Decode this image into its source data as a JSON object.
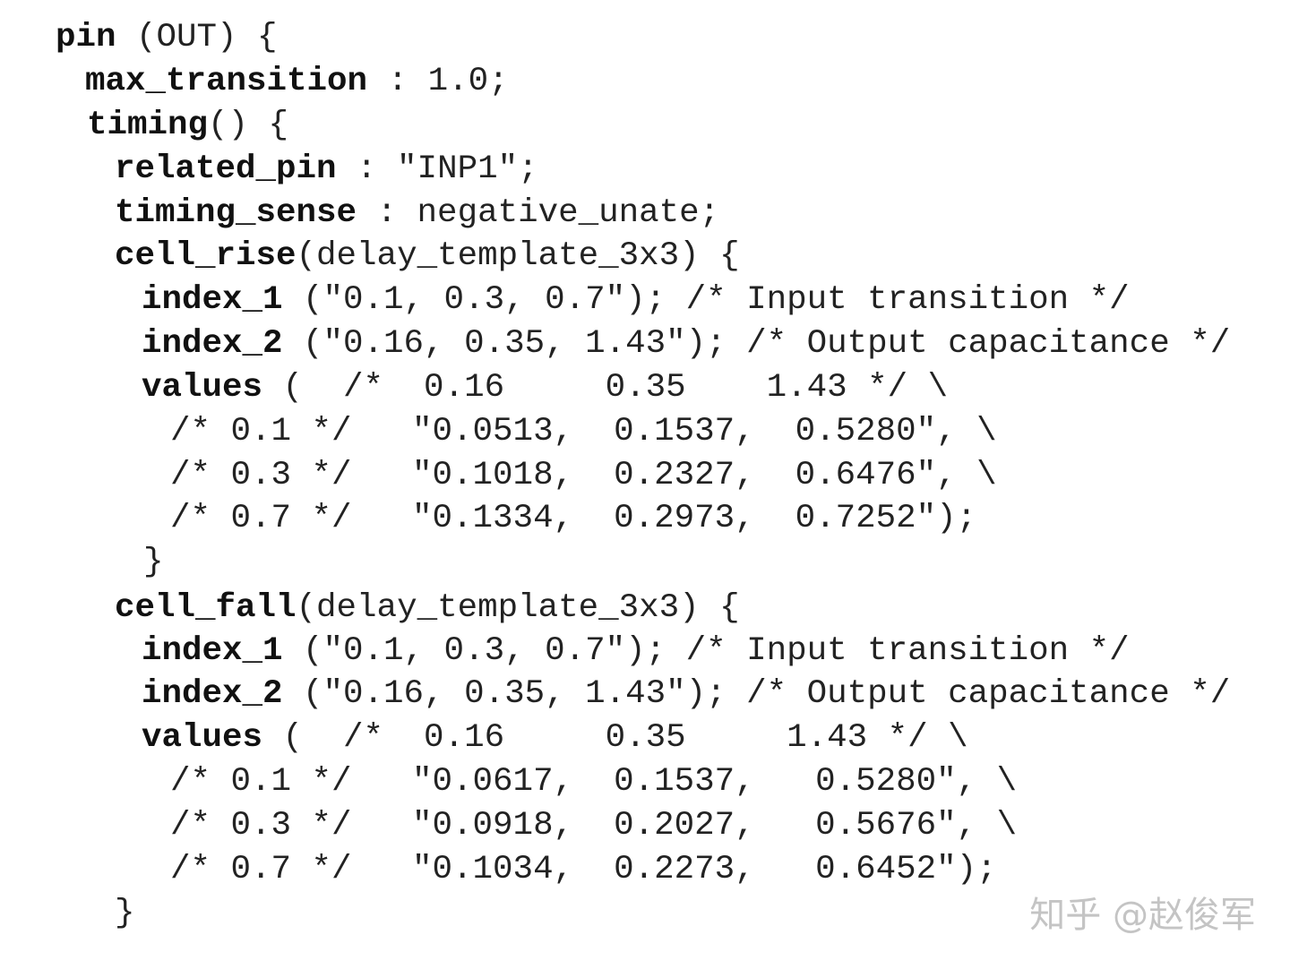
{
  "lines": [
    {
      "kw": "pin",
      "rest": " (OUT) {"
    },
    {
      "kw": "max_transition",
      "rest": " : 1.0;"
    },
    {
      "kw": "timing",
      "rest": "() {"
    },
    {
      "kw": "related_pin",
      "rest": " : \"INP1\";"
    },
    {
      "kw": "timing_sense",
      "rest": " : negative_unate;"
    },
    {
      "kw": "cell_rise",
      "rest": "(delay_template_3x3) {"
    },
    {
      "kw": "index_1",
      "rest": " (\"0.1, 0.3, 0.7\"); /* Input transition */"
    },
    {
      "kw": "index_2",
      "rest": " (\"0.16, 0.35, 1.43\"); /* Output capacitance */"
    },
    {
      "kw": "values",
      "rest": " (  /*  0.16     0.35    1.43 */ \\"
    },
    {
      "kw": "",
      "rest": "/* 0.1 */   \"0.0513,  0.1537,  0.5280\", \\"
    },
    {
      "kw": "",
      "rest": "/* 0.3 */   \"0.1018,  0.2327,  0.6476\", \\"
    },
    {
      "kw": "",
      "rest": "/* 0.7 */   \"0.1334,  0.2973,  0.7252\");"
    },
    {
      "kw": "",
      "rest": "}"
    },
    {
      "kw": "cell_fall",
      "rest": "(delay_template_3x3) {"
    },
    {
      "kw": "index_1",
      "rest": " (\"0.1, 0.3, 0.7\"); /* Input transition */"
    },
    {
      "kw": "index_2",
      "rest": " (\"0.16, 0.35, 1.43\"); /* Output capacitance */"
    },
    {
      "kw": "values",
      "rest": " (  /*  0.16     0.35     1.43 */ \\"
    },
    {
      "kw": "",
      "rest": "/* 0.1 */   \"0.0617,  0.1537,   0.5280\", \\"
    },
    {
      "kw": "",
      "rest": "/* 0.3 */   \"0.0918,  0.2027,   0.5676\", \\"
    },
    {
      "kw": "",
      "rest": "/* 0.7 */   \"0.1034,  0.2273,   0.6452\");"
    },
    {
      "kw": "",
      "rest": "}"
    }
  ],
  "watermark": "知乎 @赵俊军"
}
